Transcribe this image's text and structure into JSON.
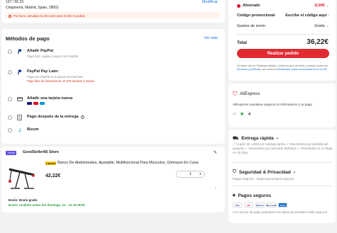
{
  "address": {
    "line1": "137 / 56 23",
    "line2": "Chapinería, Madrid, Spain, 28001",
    "modify_label": "Modificar",
    "warning": "Por favor, actualiza tu dirección para recibir el pedido"
  },
  "payment": {
    "title": "Métodos de pago",
    "see_more": "Ver más",
    "options": [
      {
        "title": "Añadir PayPal",
        "sub": "Pago fácil, rápido y seguro con PayPal"
      },
      {
        "title": "PayPal Pay Later",
        "sub": "Paga con PayPal en 3 plazos sin intereses",
        "sub2": "Pago libre de intereses de 12,07€ durante 3 meses"
      },
      {
        "title": "Añadir una tarjeta nueva"
      },
      {
        "title": "Pago después de la entrega"
      },
      {
        "title": "Bizum"
      }
    ]
  },
  "order": {
    "store_badge": "Tienda",
    "store_name": "GoodSeller66 Store",
    "lp_badge": "Lpcost",
    "product_title": "Banco De Abdominales, Ajustable, Multifuncional Para Músculos, Gimnasio En Casa",
    "price": "42,22€",
    "qty_minus": "−",
    "quantity": "1",
    "qty_plus": "+",
    "ship_title": "Envío: Envío gratis",
    "ship_date": "Envío: recíbelo antes del domingo, 21 - 22 de MAR"
  },
  "summary": {
    "savings_label": "Ahorrado",
    "savings_value": "-6,00€",
    "promo_label": "Código promocional",
    "promo_value": "Escribe el código aquí",
    "shipping_label": "Gastos de envío",
    "shipping_value": "Gratis",
    "total_label": "Total",
    "total_value": "36,22€",
    "order_button": "Realizar pedido",
    "legal_1": "Al hacer clic en 'Realizar pedido', confirmo que he leído y acepto todos los",
    "legal_link_1": "términos y políticas",
    "legal_2": ", así como la",
    "legal_link_2": "información para consumidores en la UE."
  },
  "aliexpress": {
    "brand": "AliExpress",
    "desc": "AliExpress mantiene seguros tu información y tu pago",
    "icons": [
      "pci-icon",
      "tls-icon",
      "privacy-icon"
    ]
  },
  "features": {
    "fast_title": "Entrega rápida",
    "fast_desc": "✓ Cupón de 1,00€ por entrega tardía  ✓ Reembolso por pérdida del paquete  ✓ Reembolso por artículos dañados  ✓ Reembolso si no llega en 20 días",
    "security_title": "Seguridad & Privacidad",
    "security_desc": "Pagos seguros · Datos personales seguros",
    "payments_title": "Pagos seguros",
    "payment_logos": [
      "VISA",
      "MC",
      "Maestro",
      "Bancontact",
      "Amex"
    ],
    "payments_desc": "Con socios de pago populares tus datos personales están seguros"
  },
  "colors": {
    "accent": "#e02b31",
    "link": "#1a73e8",
    "success": "#2e9e44"
  }
}
